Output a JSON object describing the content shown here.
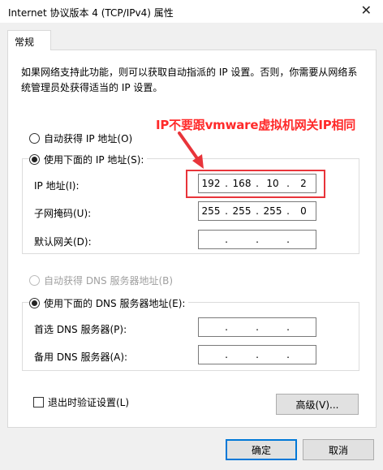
{
  "window": {
    "title": "Internet 协议版本 4 (TCP/IPv4) 属性",
    "close_glyph": "✕"
  },
  "tabs": [
    {
      "label": "常规"
    }
  ],
  "description": "如果网络支持此功能，则可以获取自动指派的 IP 设置。否则，你需要从网络系统管理员处获得适当的 IP 设置。",
  "ip_section": {
    "auto_label": "自动获得 IP 地址(O)",
    "manual_label": "使用下面的 IP 地址(S):",
    "selected": "manual",
    "ip_label": "IP 地址(I):",
    "ip_value": [
      "192",
      "168",
      "10",
      "2"
    ],
    "mask_label": "子网掩码(U):",
    "mask_value": [
      "255",
      "255",
      "255",
      "0"
    ],
    "gateway_label": "默认网关(D):",
    "gateway_value": [
      "",
      "",
      "",
      ""
    ]
  },
  "dns_section": {
    "auto_label": "自动获得 DNS 服务器地址(B)",
    "manual_label": "使用下面的 DNS 服务器地址(E):",
    "selected": "manual",
    "preferred_label": "首选 DNS 服务器(P):",
    "preferred_value": [
      "",
      "",
      "",
      ""
    ],
    "alternate_label": "备用 DNS 服务器(A):",
    "alternate_value": [
      "",
      "",
      "",
      ""
    ]
  },
  "annotation": {
    "text": "IP不要跟vmware虚拟机网关IP相同",
    "color": "#ff2a2a"
  },
  "validate_label": "退出时验证设置(L)",
  "buttons": {
    "advanced": "高级(V)...",
    "ok": "确定",
    "cancel": "取消"
  }
}
